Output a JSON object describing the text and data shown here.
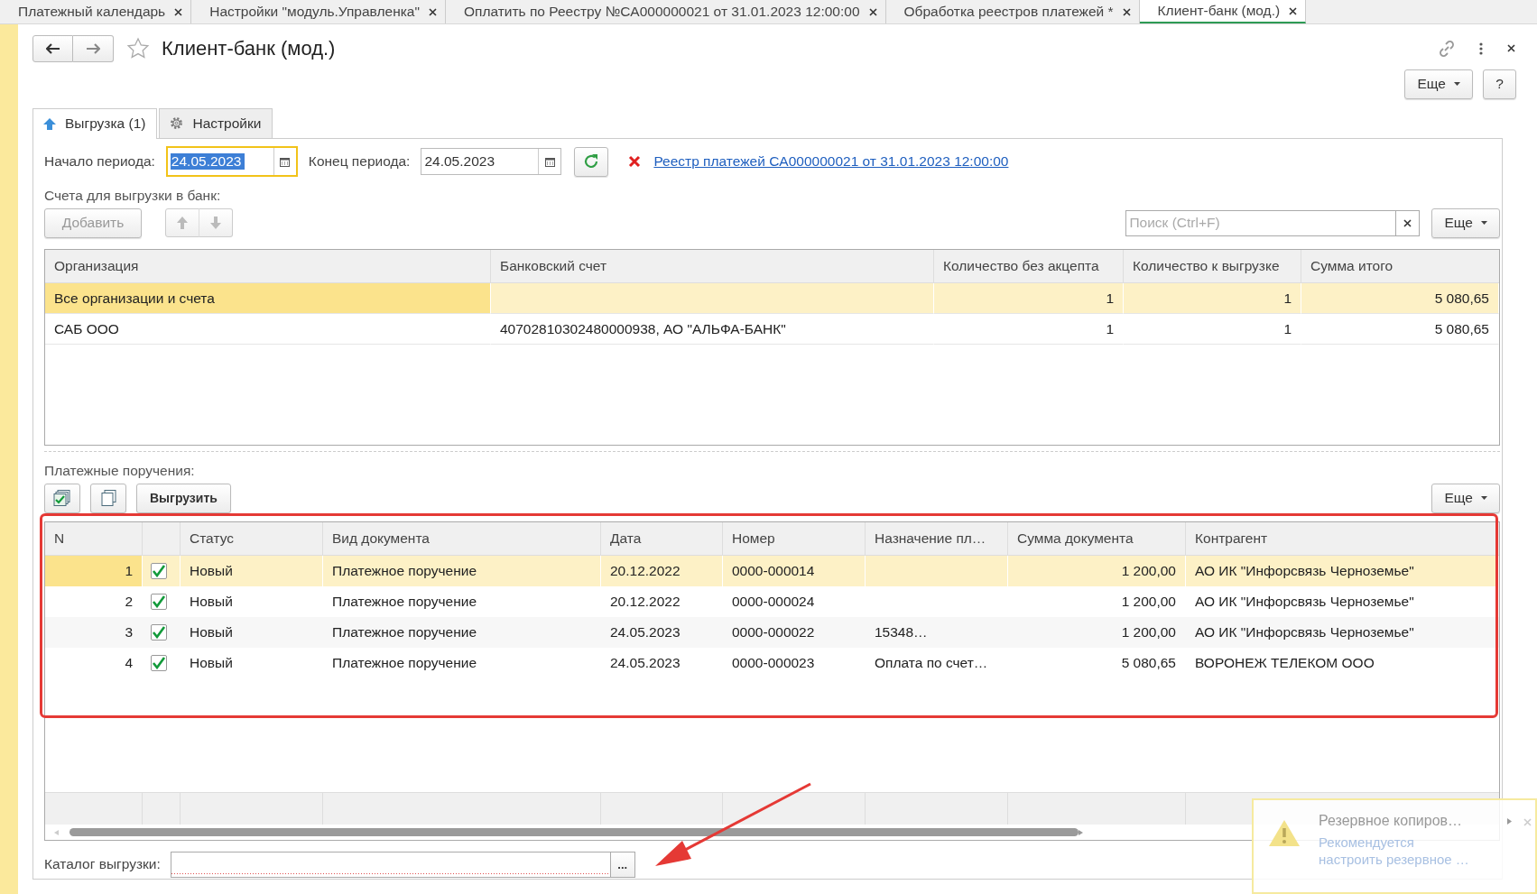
{
  "open_tabs": [
    {
      "label": "Платежный календарь",
      "selected": false
    },
    {
      "label": "Настройки \"модуль.Управленка\"",
      "selected": false
    },
    {
      "label": "Оплатить по Реестру №CA000000021 от 31.01.2023 12:00:00",
      "selected": false
    },
    {
      "label": "Обработка реестров платежей *",
      "selected": false
    },
    {
      "label": "Клиент-банк (мод.)",
      "selected": true
    }
  ],
  "window": {
    "title": "Клиент-банк (мод.)"
  },
  "top_buttons": {
    "more": "Еще",
    "help": "?"
  },
  "form_tabs": [
    {
      "label": "Выгрузка (1)",
      "selected": true,
      "kind": "upload"
    },
    {
      "label": "Настройки",
      "selected": false,
      "kind": "settings"
    }
  ],
  "period": {
    "start_label": "Начало периода:",
    "start_value": "24.05.2023",
    "end_label": "Конец периода:",
    "end_value": "24.05.2023",
    "link": "Реестр платежей CA000000021 от 31.01.2023 12:00:00"
  },
  "accounts": {
    "caption": "Счета для выгрузки в банк:",
    "add_button": "Добавить",
    "search": {
      "placeholder": "Поиск (Ctrl+F)"
    },
    "more": "Еще",
    "columns": [
      {
        "title": "Организация",
        "kind": "text"
      },
      {
        "title": "Банковский счет",
        "kind": "text"
      },
      {
        "title": "Количество без акцепта",
        "kind": "number"
      },
      {
        "title": "Количество к выгрузке",
        "kind": "number"
      },
      {
        "title": "Сумма итого",
        "kind": "number"
      }
    ],
    "rows": [
      {
        "selected": true,
        "cells": [
          "Все организации и счета",
          "",
          "1",
          "1",
          "5 080,65"
        ]
      },
      {
        "selected": false,
        "cells": [
          "САБ ООО",
          "40702810302480000938, АО \"АЛЬФА-БАНК\"",
          "1",
          "1",
          "5 080,65"
        ]
      }
    ]
  },
  "orders": {
    "caption": "Платежные поручения:",
    "export_button": "Выгрузить",
    "more": "Еще",
    "columns": [
      {
        "title": "N",
        "kind": "number"
      },
      {
        "kind": "check"
      },
      {
        "title": "Статус",
        "kind": "text"
      },
      {
        "title": "Вид документа",
        "kind": "text"
      },
      {
        "title": "Дата",
        "kind": "text"
      },
      {
        "title": "Номер",
        "kind": "text"
      },
      {
        "title": "Назначение пл…",
        "kind": "text"
      },
      {
        "title": "Сумма документа",
        "kind": "number"
      },
      {
        "title": "Контрагент",
        "kind": "text"
      }
    ],
    "rows": [
      {
        "selected": true,
        "checked": true,
        "cells": [
          "1",
          "",
          "Новый",
          "Платежное поручение",
          "20.12.2022",
          "0000-000014",
          "",
          "1 200,00",
          "АО ИК \"Инфорсвязь Черноземье\""
        ]
      },
      {
        "selected": false,
        "checked": true,
        "cells": [
          "2",
          "",
          "Новый",
          "Платежное поручение",
          "20.12.2022",
          "0000-000024",
          "",
          "1 200,00",
          "АО ИК \"Инфорсвязь Черноземье\""
        ]
      },
      {
        "selected": false,
        "checked": true,
        "cells": [
          "3",
          "",
          "Новый",
          "Платежное поручение",
          "24.05.2023",
          "0000-000022",
          "15348…",
          "1 200,00",
          "АО ИК \"Инфорсвязь Черноземье\""
        ]
      },
      {
        "selected": false,
        "checked": true,
        "cells": [
          "4",
          "",
          "Новый",
          "Платежное поручение",
          "24.05.2023",
          "0000-000023",
          "Оплата по счет…",
          "5 080,65",
          "ВОРОНЕЖ ТЕЛЕКОМ ООО"
        ]
      }
    ]
  },
  "catalog": {
    "label": "Каталог выгрузки:",
    "button": "..."
  },
  "notification": {
    "title": "Резервное копиров…",
    "lines": [
      "Рекомендуется",
      "настроить резервное …"
    ]
  }
}
